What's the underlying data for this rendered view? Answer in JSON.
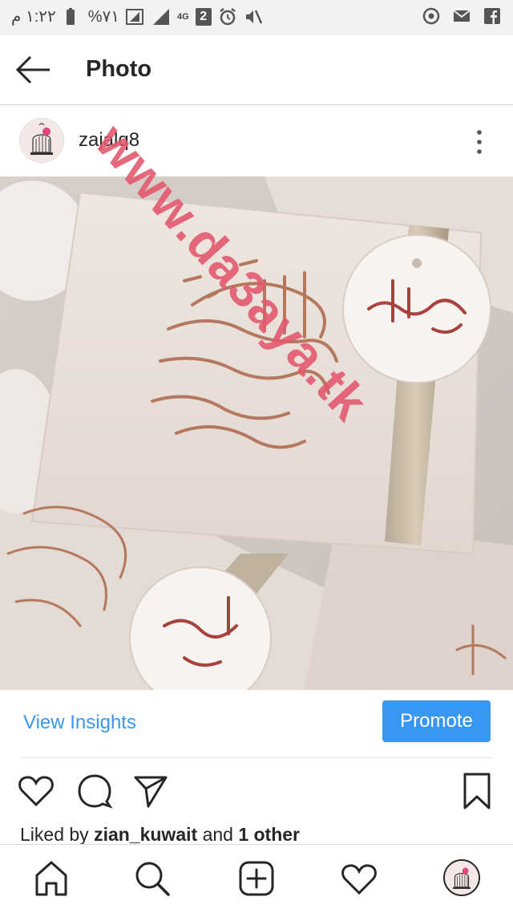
{
  "status_bar": {
    "time": "١:٢٢ م",
    "battery": "%٧١",
    "network": "4G",
    "sim_badge": "2"
  },
  "appbar": {
    "title": "Photo"
  },
  "watermark": "www.da3aya.tk",
  "post": {
    "username": "zajalq8",
    "photo_text": {
      "main_calligraphy": "اللهم أنبتها نباتاً حسناً",
      "tag_name": "أحمد"
    }
  },
  "insights": {
    "view_label": "View Insights",
    "promote_label": "Promote"
  },
  "likes": {
    "prefix": "Liked by",
    "user": "zian_kuwait",
    "middle": "and",
    "others": "1 other"
  },
  "icons": {
    "back": "arrow-left-icon",
    "more": "more-vertical-icon",
    "like": "heart-icon",
    "comment": "comment-icon",
    "share": "send-icon",
    "save": "bookmark-icon",
    "home": "home-icon",
    "search": "search-icon",
    "add": "add-post-icon",
    "activity": "heart-icon"
  },
  "colors": {
    "accent": "#3897f0",
    "watermark": "#e35a6f",
    "gold": "#b4785e"
  }
}
